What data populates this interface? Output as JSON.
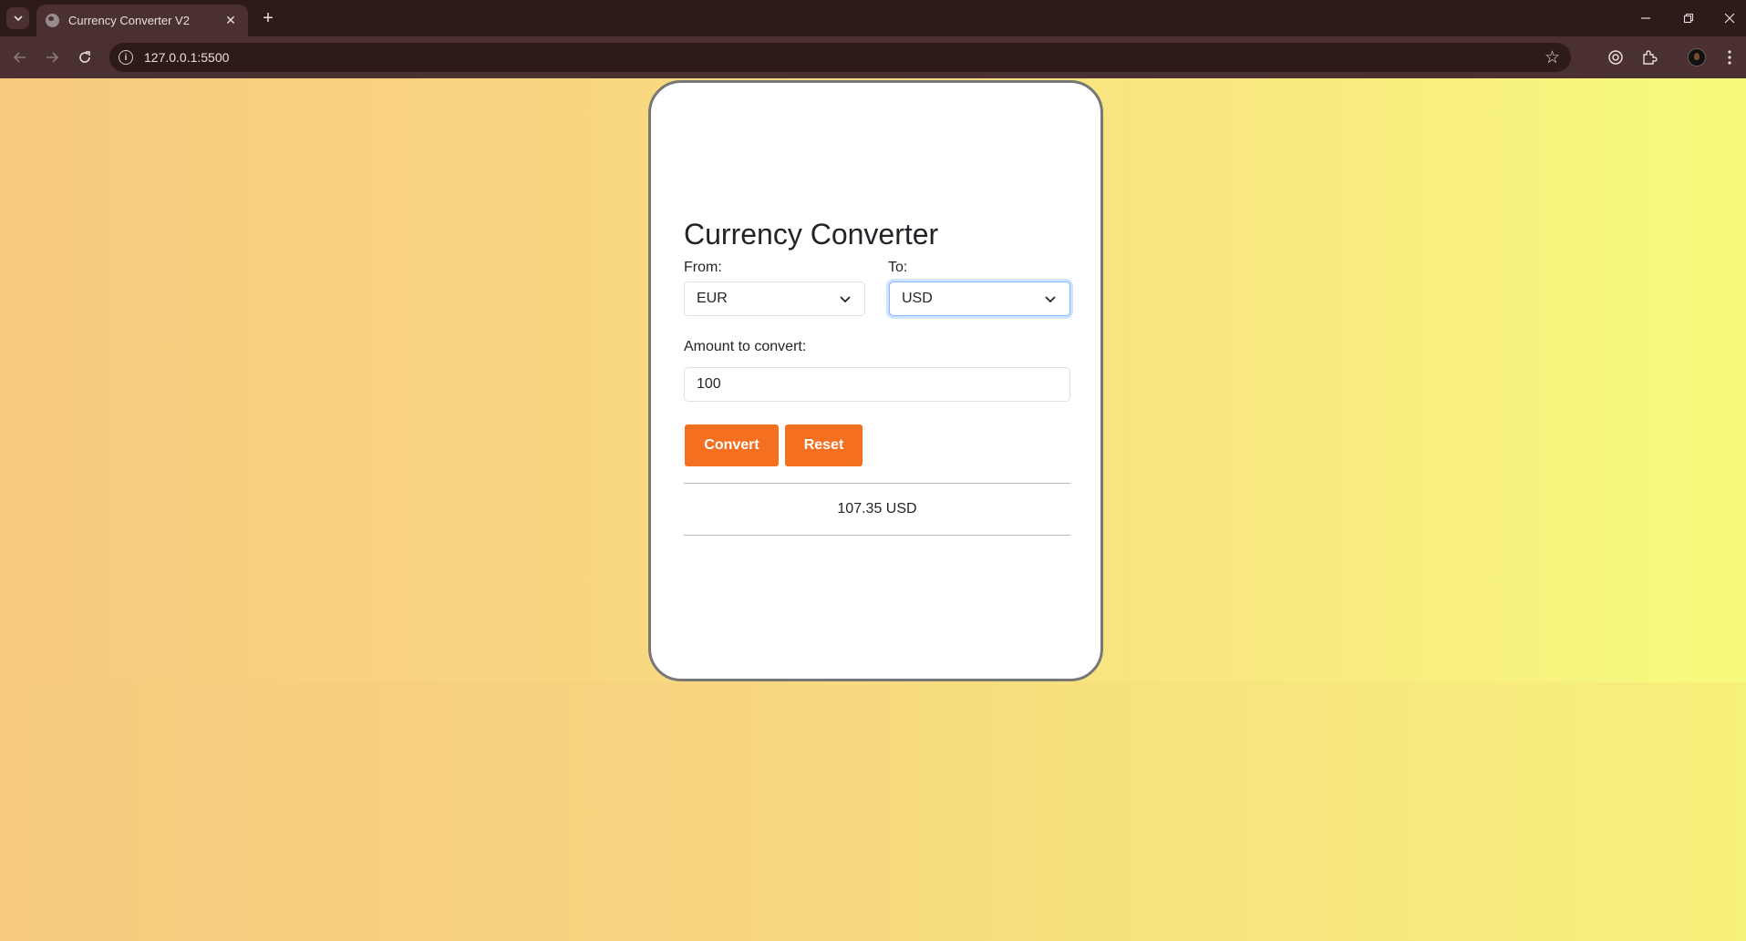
{
  "browser": {
    "tab_title": "Currency Converter V2",
    "url": "127.0.0.1:5500"
  },
  "converter": {
    "title": "Currency Converter",
    "from_label": "From:",
    "from_value": "EUR",
    "to_label": "To:",
    "to_value": "USD",
    "amount_label": "Amount to convert:",
    "amount_value": "100",
    "convert_label": "Convert",
    "reset_label": "Reset",
    "result": "107.35 USD"
  },
  "colors": {
    "accent": "#f47020",
    "card_border": "#777777",
    "focus": "#86b7fe"
  }
}
